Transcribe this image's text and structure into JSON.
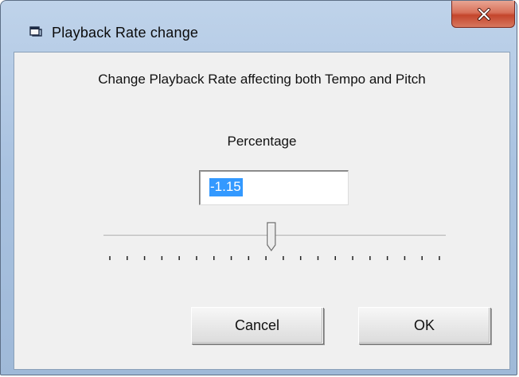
{
  "window": {
    "title": "Playback Rate change",
    "icon": "dialog-window-icon",
    "close_icon": "close-icon"
  },
  "dialog": {
    "description": "Change Playback Rate affecting both Tempo and Pitch",
    "percentage_label": "Percentage",
    "percentage_value": "-1.15"
  },
  "slider": {
    "tick_count": 20,
    "thumb_position_fraction": 0.49
  },
  "buttons": {
    "cancel_label": "Cancel",
    "ok_label": "OK"
  }
}
